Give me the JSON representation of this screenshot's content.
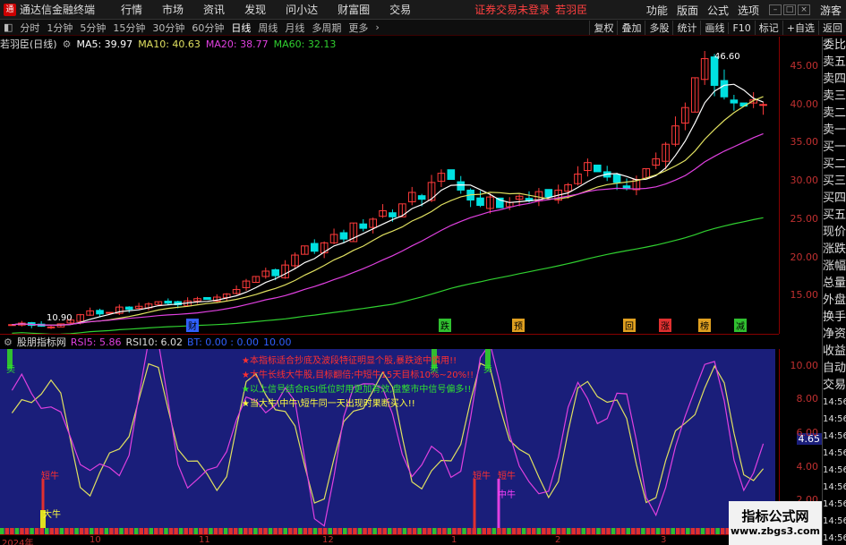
{
  "app": {
    "title": "通达信金融终端",
    "warning": "证券交易未登录",
    "stock_short": "若羽臣",
    "guest": "游客"
  },
  "menu": [
    "行情",
    "市场",
    "资讯",
    "发现",
    "问小达",
    "财富圈",
    "交易"
  ],
  "right_menu": [
    "功能",
    "版面",
    "公式",
    "选项"
  ],
  "toolbar": {
    "periods": [
      "分时",
      "1分钟",
      "5分钟",
      "15分钟",
      "30分钟",
      "60分钟",
      "日线",
      "周线",
      "月线",
      "多周期",
      "更多"
    ],
    "active": "日线",
    "right": [
      "复权",
      "叠加",
      "多股",
      "统计",
      "画线",
      "F10",
      "标记",
      "+自选",
      "返回"
    ]
  },
  "info": {
    "name": "若羽臣(日线)",
    "ma5": "MA5: 39.97",
    "ma10": "MA10: 40.63",
    "ma20": "MA20: 38.77",
    "ma60": "MA60: 32.13"
  },
  "price_axis": [
    "45.00",
    "40.00",
    "35.00",
    "30.00",
    "25.00",
    "20.00",
    "15.00"
  ],
  "annotations": {
    "high": "46.60",
    "low": "10.90"
  },
  "news": [
    {
      "t": "财",
      "c": "#3060ff"
    },
    {
      "t": "跌",
      "c": "#30c030"
    },
    {
      "t": "预",
      "c": "#e0a020"
    },
    {
      "t": "回",
      "c": "#e0a020"
    },
    {
      "t": "涨",
      "c": "#e03030"
    },
    {
      "t": "榜",
      "c": "#e0a020"
    },
    {
      "t": "减",
      "c": "#30c030"
    }
  ],
  "indicator": {
    "name": "股朋指标网",
    "rsi5": "RSI5: 5.86",
    "rsi10": "RSI10: 6.02",
    "bt": "BT: 0.00 : 0.00",
    "ten": "10.00",
    "axis": [
      "10.00",
      "8.00",
      "6.00",
      "4.00",
      "2.00"
    ],
    "current": "4.65",
    "messages": [
      "★本指标适合抄底及波段特征明显个股,暴跌途中慎用!!",
      "★大牛长线大牛股,目标翻倍;中短牛15天目标10%~20%!!",
      "★以上信号结合RSI低位时用更加有效,盘整市中信号偏多!!",
      "★当大牛\\中牛\\短牛同一天出现时果断买入!!"
    ],
    "labels": {
      "sell": "卖",
      "short_bull": "短牛",
      "mid_bull": "中牛",
      "big_bull": "大牛"
    }
  },
  "dates": [
    "2024年",
    "10",
    "11",
    "12",
    "1",
    "2",
    "3"
  ],
  "side": [
    "委比",
    "卖五",
    "卖四",
    "卖三",
    "卖二",
    "卖一",
    "买一",
    "买二",
    "买三",
    "买四",
    "买五",
    "现价",
    "涨跌",
    "涨幅",
    "总量",
    "外盘",
    "换手",
    "净资",
    "收益",
    "自动",
    "交易",
    "14:56",
    "14:56",
    "14:56",
    "14:56",
    "14:56",
    "14:56",
    "14:56",
    "14:56",
    "14:56"
  ],
  "watermark": {
    "l1": "指标公式网",
    "l2": "www.zbgs3.com"
  },
  "colors": {
    "up": "#ff3b3b",
    "down": "#00e0e0",
    "ma5": "#ffffff",
    "ma10": "#e0e060",
    "ma20": "#e040e0",
    "ma60": "#30d030"
  },
  "chart_data": {
    "type": "candlestick",
    "price_range": [
      10,
      47
    ],
    "closes": [
      11.2,
      11.4,
      11.1,
      11.0,
      10.9,
      11.3,
      11.8,
      12.5,
      13.0,
      12.6,
      12.8,
      13.5,
      13.2,
      13.6,
      13.9,
      14.2,
      14.0,
      13.8,
      14.3,
      14.6,
      14.5,
      14.8,
      15.2,
      15.8,
      16.9,
      17.5,
      18.2,
      17.6,
      19.0,
      20.3,
      21.5,
      20.8,
      21.9,
      23.0,
      22.4,
      24.5,
      23.8,
      25.0,
      26.1,
      25.3,
      27.0,
      28.5,
      27.6,
      29.8,
      31.0,
      30.2,
      28.8,
      27.5,
      26.8,
      27.9,
      26.5,
      27.2,
      28.0,
      27.4,
      28.6,
      27.9,
      28.8,
      29.5,
      30.9,
      32.4,
      31.2,
      30.5,
      29.8,
      29.0,
      30.2,
      31.6,
      32.9,
      34.8,
      37.2,
      39.6,
      43.5,
      46.0,
      42.5,
      41.0,
      40.2,
      39.8,
      40.6,
      40.0
    ]
  }
}
